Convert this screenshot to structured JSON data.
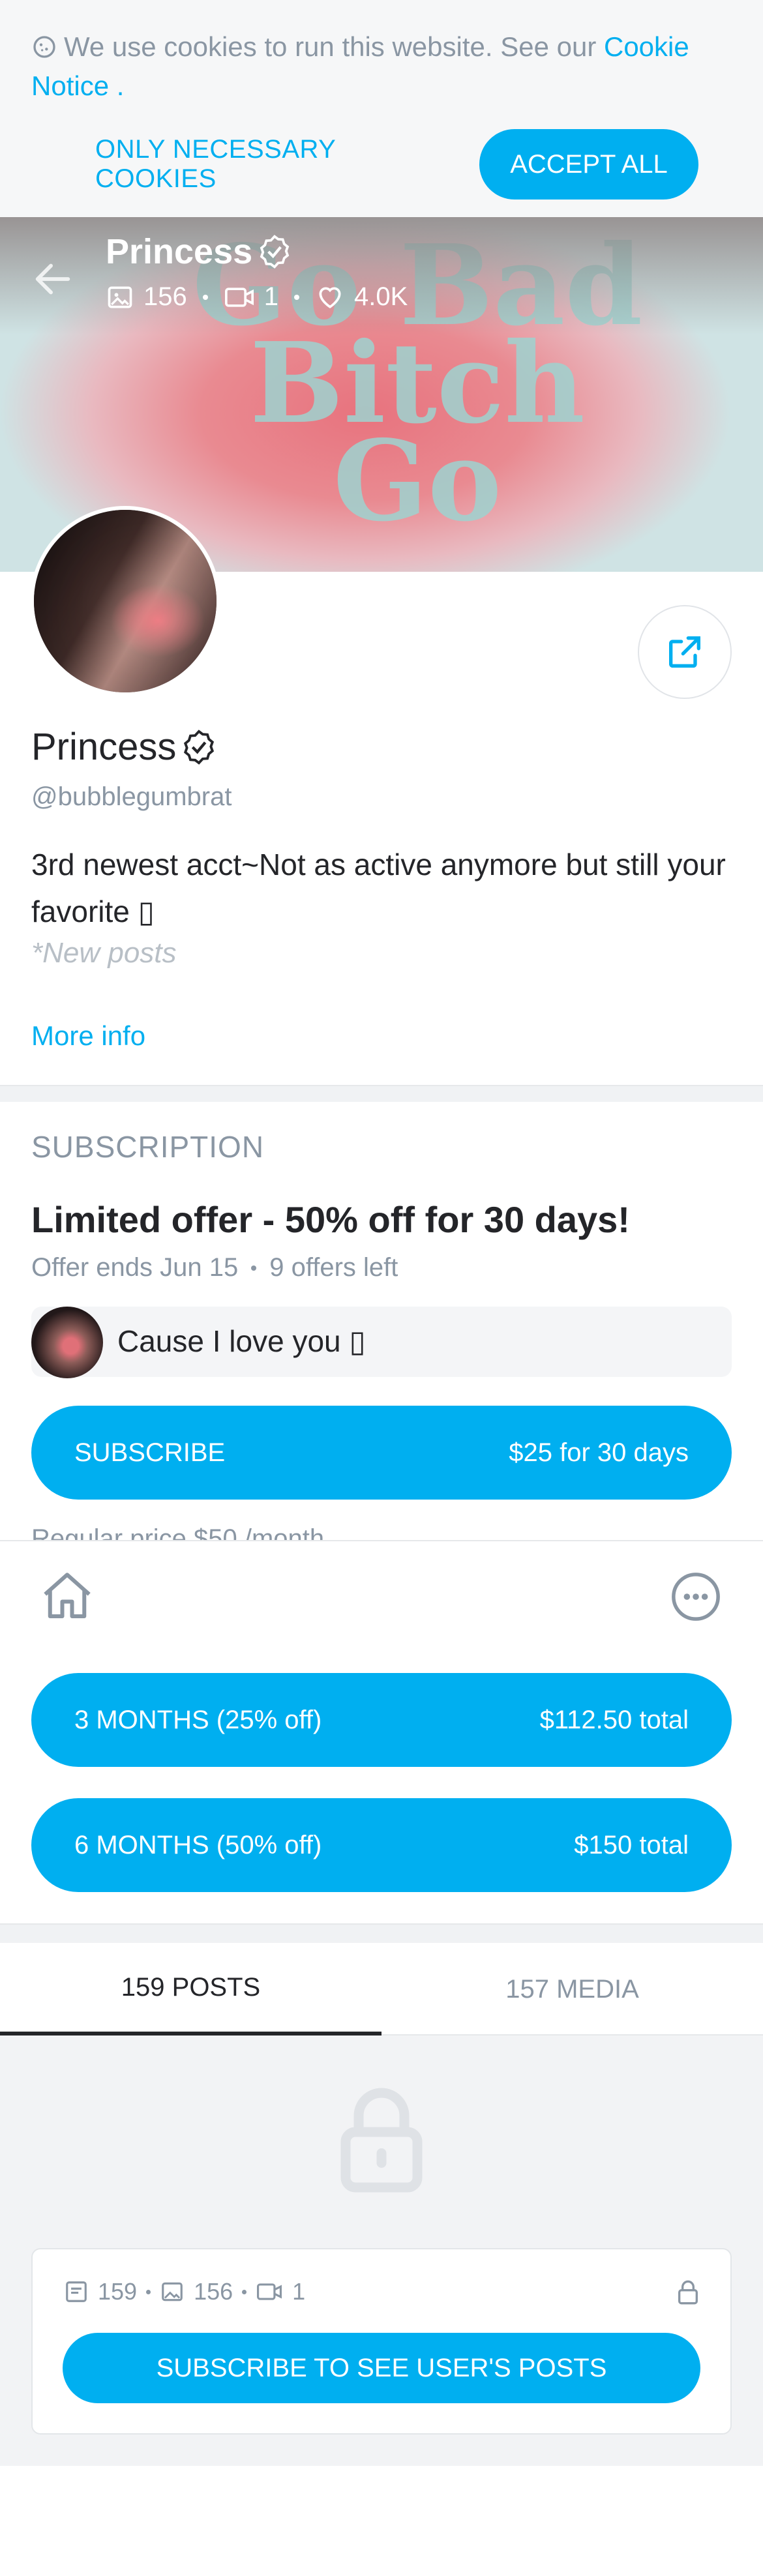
{
  "cookie": {
    "text": "We use cookies to run this website. See our ",
    "link": "Cookie Notice",
    "after": " .",
    "necessary_label": "ONLY NECESSARY COOKIES",
    "accept_label": "ACCEPT ALL"
  },
  "cover": {
    "art_text": "Go Bad Bitch Go"
  },
  "header": {
    "name": "Princess",
    "photos": "156",
    "videos": "1",
    "likes": "4.0K"
  },
  "profile": {
    "name": "Princess",
    "handle": "@bubblegumbrat",
    "bio": "3rd newest acct~Not as active anymore but still your favorite ▯",
    "bio_more": "*New posts",
    "more_info": "More info"
  },
  "subscription": {
    "section_title": "SUBSCRIPTION",
    "offer_title": "Limited offer - 50% off for 30 days!",
    "offer_ends": "Offer ends Jun 15",
    "offers_left": "9 offers left",
    "message": "Cause I love you ▯",
    "subscribe_label": "SUBSCRIBE",
    "subscribe_price": "$25 for 30 days",
    "regular_price": "Regular price $50 /month",
    "bundle1_label": "3 MONTHS (25% off)",
    "bundle1_price": "$112.50 total",
    "bundle2_label": "6 MONTHS (50% off)",
    "bundle2_price": "$150 total"
  },
  "tabs": {
    "posts": "159 POSTS",
    "media": "157 MEDIA"
  },
  "locked": {
    "posts": "159",
    "photos": "156",
    "videos": "1",
    "button": "SUBSCRIBE TO SEE USER'S POSTS"
  },
  "colors": {
    "accent": "#00aff0",
    "muted": "#8a96a3",
    "text": "#242529"
  }
}
